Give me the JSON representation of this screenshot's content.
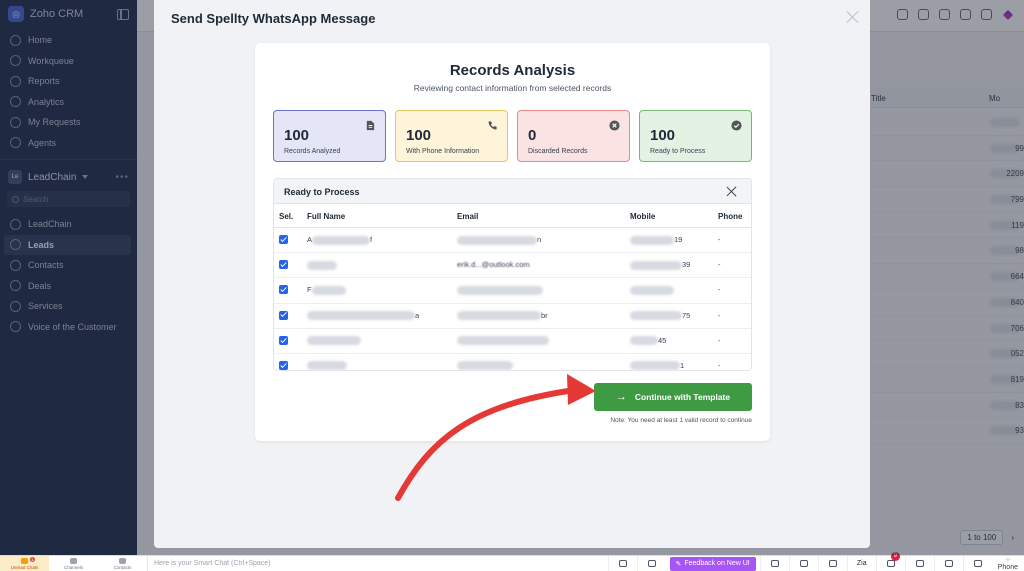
{
  "sidebar": {
    "app_title": "Zoho CRM",
    "items": [
      {
        "label": "Home",
        "icon": "home-icon"
      },
      {
        "label": "Workqueue",
        "icon": "workqueue-icon"
      },
      {
        "label": "Reports",
        "icon": "reports-icon"
      },
      {
        "label": "Analytics",
        "icon": "analytics-icon"
      },
      {
        "label": "My Requests",
        "icon": "requests-icon"
      },
      {
        "label": "Agents",
        "icon": "agents-icon"
      }
    ],
    "team": {
      "badge": "Le",
      "name": "LeadChain"
    },
    "search_placeholder": "Search",
    "modules": [
      {
        "label": "LeadChain"
      },
      {
        "label": "Leads",
        "active": true
      },
      {
        "label": "Contacts"
      },
      {
        "label": "Deals"
      },
      {
        "label": "Services"
      },
      {
        "label": "Voice of the Customer"
      }
    ]
  },
  "background": {
    "column_title": "Title",
    "column_mobile": "Mo",
    "row_values": [
      "",
      "99",
      "2209",
      "799",
      "119",
      "98",
      "664",
      "840",
      "706",
      "052",
      "819",
      "83",
      "93"
    ],
    "pager": "1 to 100"
  },
  "modal": {
    "title": "Send Spellty WhatsApp Message",
    "card_title": "Records Analysis",
    "card_subtitle": "Reviewing contact information from selected records",
    "stats": [
      {
        "value": "100",
        "label": "Records Analyzed",
        "icon": "document-icon"
      },
      {
        "value": "100",
        "label": "With Phone Information",
        "icon": "phone-icon"
      },
      {
        "value": "0",
        "label": "Discarded Records",
        "icon": "x-circle-icon"
      },
      {
        "value": "100",
        "label": "Ready to Process",
        "icon": "check-circle-icon"
      }
    ],
    "table": {
      "title": "Ready to Process",
      "columns": {
        "sel": "Sel.",
        "name": "Full Name",
        "email": "Email",
        "mobile": "Mobile",
        "phone": "Phone"
      },
      "rows": [
        {
          "name_prefix": "A",
          "name_suffix": "f",
          "email_suffix": "n",
          "mobile_suffix": "19",
          "phone": "-"
        },
        {
          "name_prefix": "",
          "name_suffix": "",
          "email_suffix": "erik.d...@outlook.com",
          "mobile_suffix": "39",
          "phone": "-"
        },
        {
          "name_prefix": "F",
          "name_suffix": "",
          "email_suffix": "",
          "mobile_suffix": "",
          "phone": "-"
        },
        {
          "name_prefix": "",
          "name_suffix": "a",
          "email_suffix": "br",
          "mobile_suffix": "75",
          "phone": "-"
        },
        {
          "name_prefix": "",
          "name_suffix": "",
          "email_suffix": "",
          "mobile_suffix": "45",
          "phone": "-"
        },
        {
          "name_prefix": "",
          "name_suffix": "",
          "email_suffix": "",
          "mobile_suffix": "1",
          "phone": "-"
        }
      ]
    },
    "cta_label": "Continue with Template",
    "note": "Note: You need at least 1 valid record to continue"
  },
  "bottombar": {
    "tabs": [
      {
        "label": "Unread Chats"
      },
      {
        "label": "Channels"
      },
      {
        "label": "Contacts"
      }
    ],
    "unread_count": "1",
    "smart_chat_placeholder": "Here is your Smart Chat (Ctrl+Space)",
    "feedback_label": "Feedback on New UI",
    "zia_label": "Zia",
    "reminder_count": "9",
    "phone_label": "Phone"
  },
  "colors": {
    "sidebar_bg": "#2b3656",
    "cta_green": "#3e9b44",
    "annotation_red": "#e53935",
    "feedback_purple": "#a855f7"
  }
}
